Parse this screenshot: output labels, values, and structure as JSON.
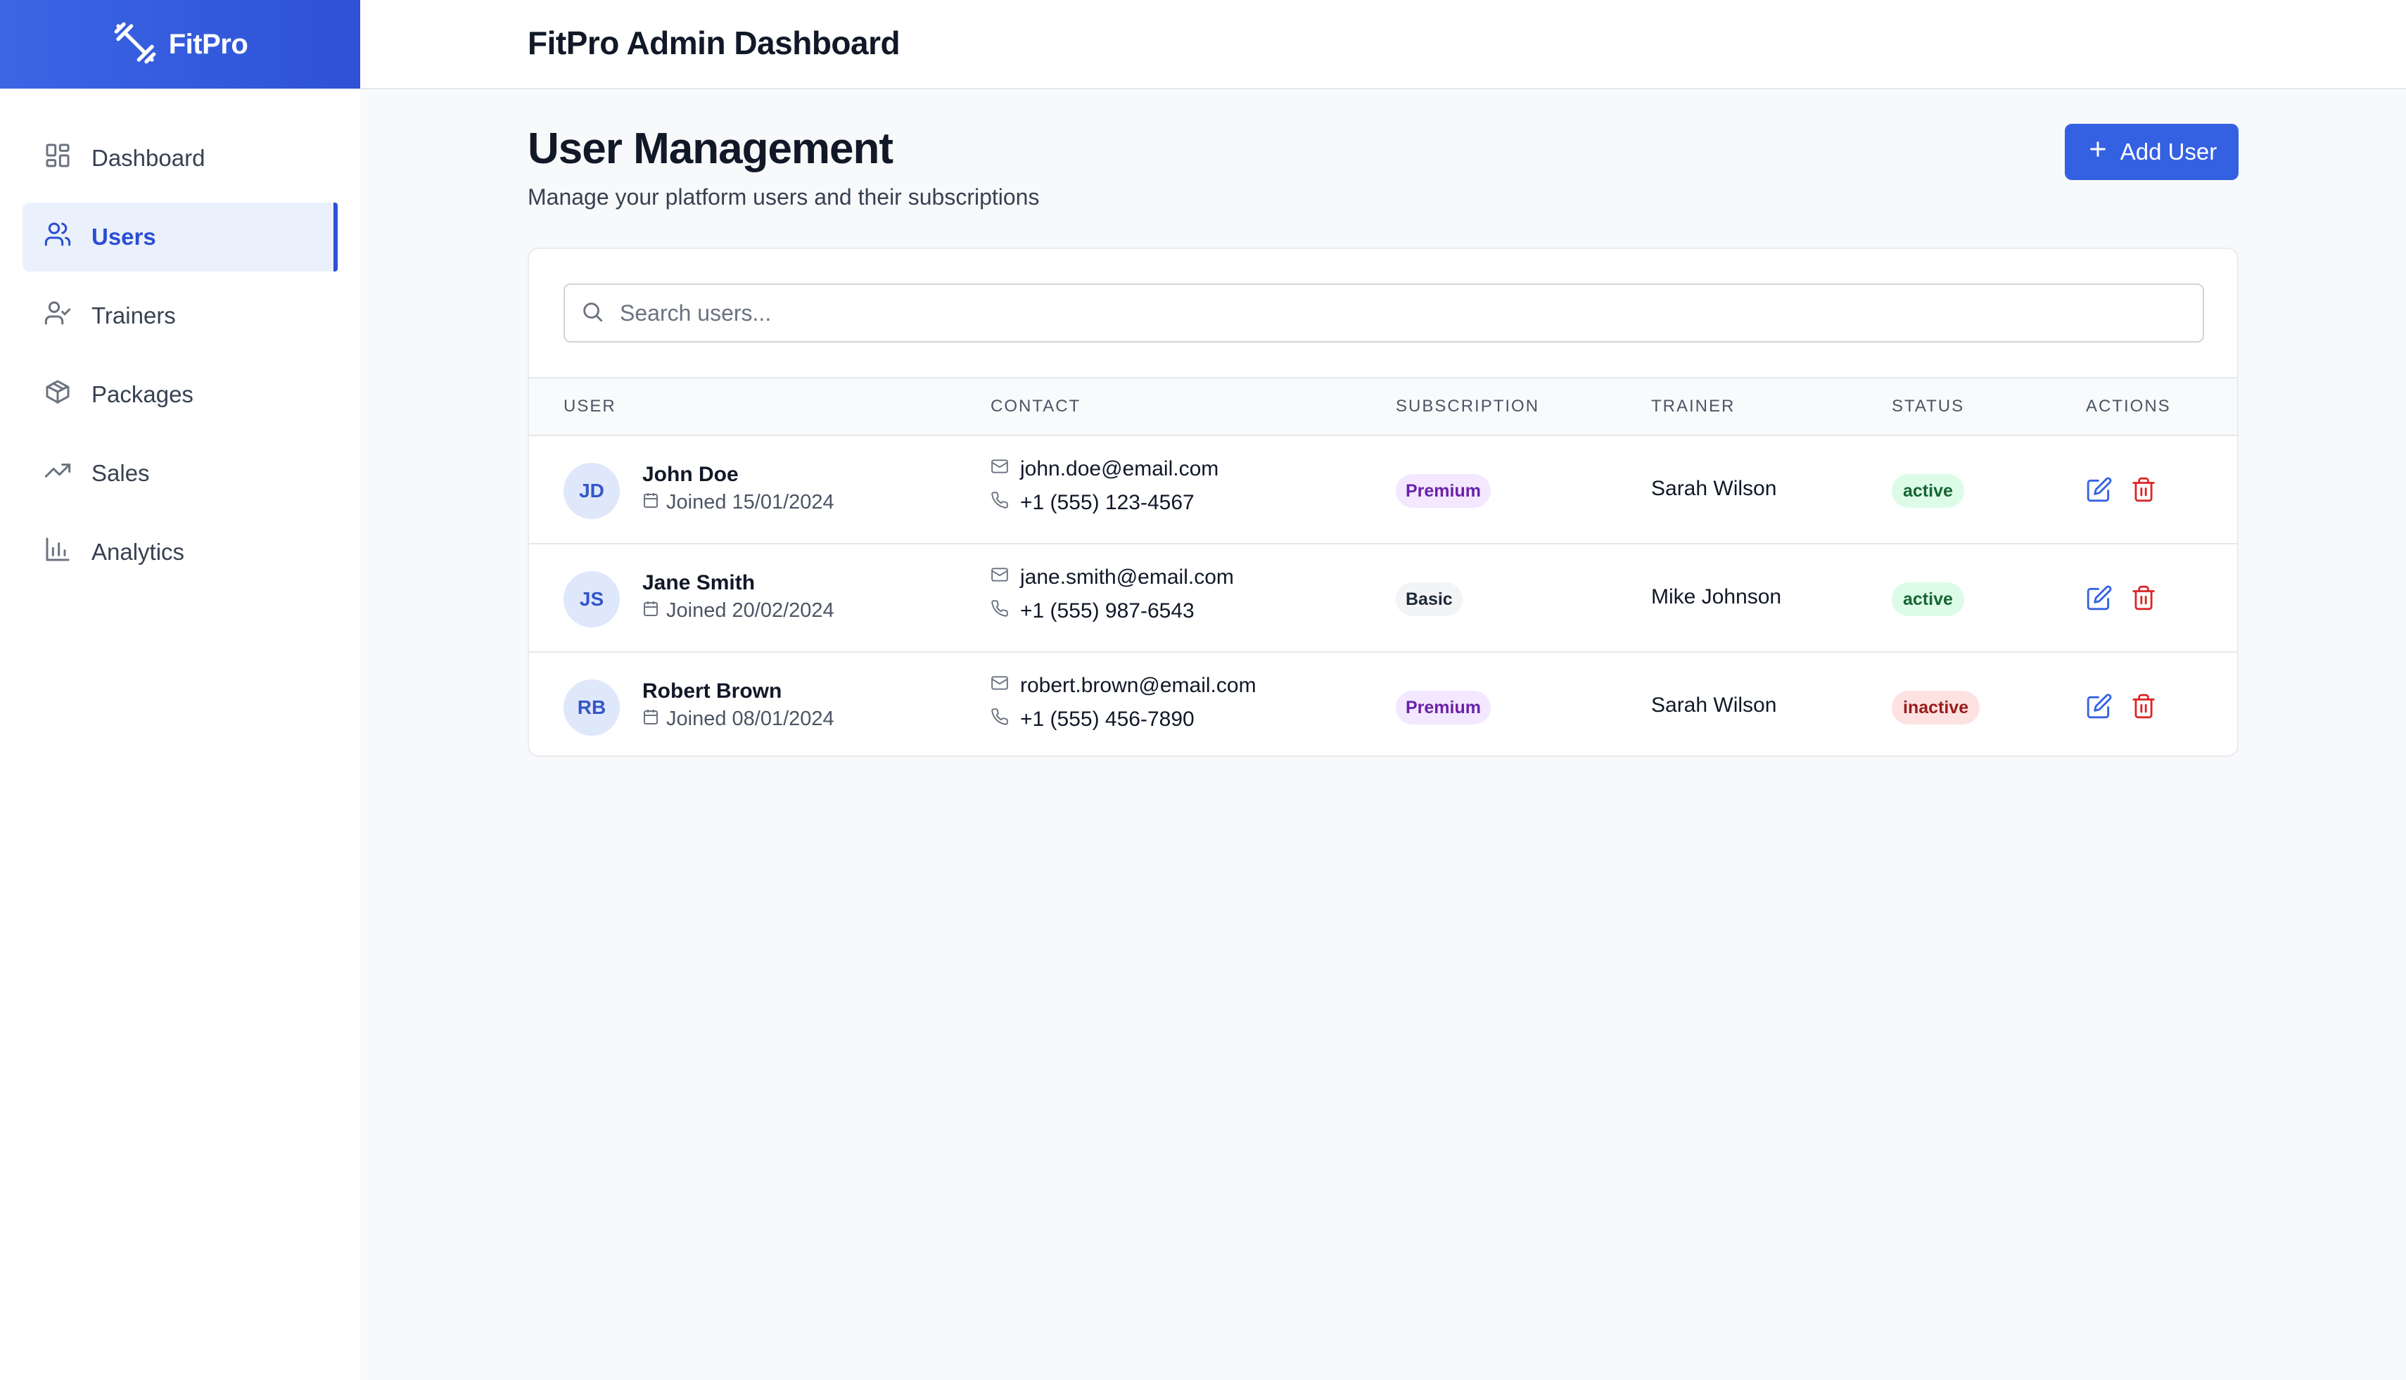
{
  "brand": {
    "name": "FitPro"
  },
  "sidebar": {
    "items": [
      {
        "label": "Dashboard",
        "icon": "dashboard-grid-icon"
      },
      {
        "label": "Users",
        "icon": "users-icon",
        "active": true
      },
      {
        "label": "Trainers",
        "icon": "user-check-icon"
      },
      {
        "label": "Packages",
        "icon": "package-box-icon"
      },
      {
        "label": "Sales",
        "icon": "trending-up-icon"
      },
      {
        "label": "Analytics",
        "icon": "bar-chart-icon"
      }
    ]
  },
  "topbar": {
    "title": "FitPro Admin Dashboard"
  },
  "page": {
    "title": "User Management",
    "subtitle": "Manage your platform users and their subscriptions",
    "add_button": "Add User"
  },
  "search": {
    "placeholder": "Search users...",
    "value": ""
  },
  "table": {
    "headers": [
      "USER",
      "CONTACT",
      "SUBSCRIPTION",
      "TRAINER",
      "STATUS",
      "ACTIONS"
    ],
    "rows": [
      {
        "initials": "JD",
        "name": "John Doe",
        "joined": "Joined 15/01/2024",
        "email": "john.doe@email.com",
        "phone": "+1 (555) 123-4567",
        "subscription": "Premium",
        "trainer": "Sarah Wilson",
        "status": "active"
      },
      {
        "initials": "JS",
        "name": "Jane Smith",
        "joined": "Joined 20/02/2024",
        "email": "jane.smith@email.com",
        "phone": "+1 (555) 987-6543",
        "subscription": "Basic",
        "trainer": "Mike Johnson",
        "status": "active"
      },
      {
        "initials": "RB",
        "name": "Robert Brown",
        "joined": "Joined 08/01/2024",
        "email": "robert.brown@email.com",
        "phone": "+1 (555) 456-7890",
        "subscription": "Premium",
        "trainer": "Sarah Wilson",
        "status": "inactive"
      }
    ]
  },
  "colors": {
    "accent": "#3461e2",
    "premium": "#6b21a8",
    "active": "#166534",
    "inactive": "#991b1b",
    "delete": "#dc2626"
  }
}
